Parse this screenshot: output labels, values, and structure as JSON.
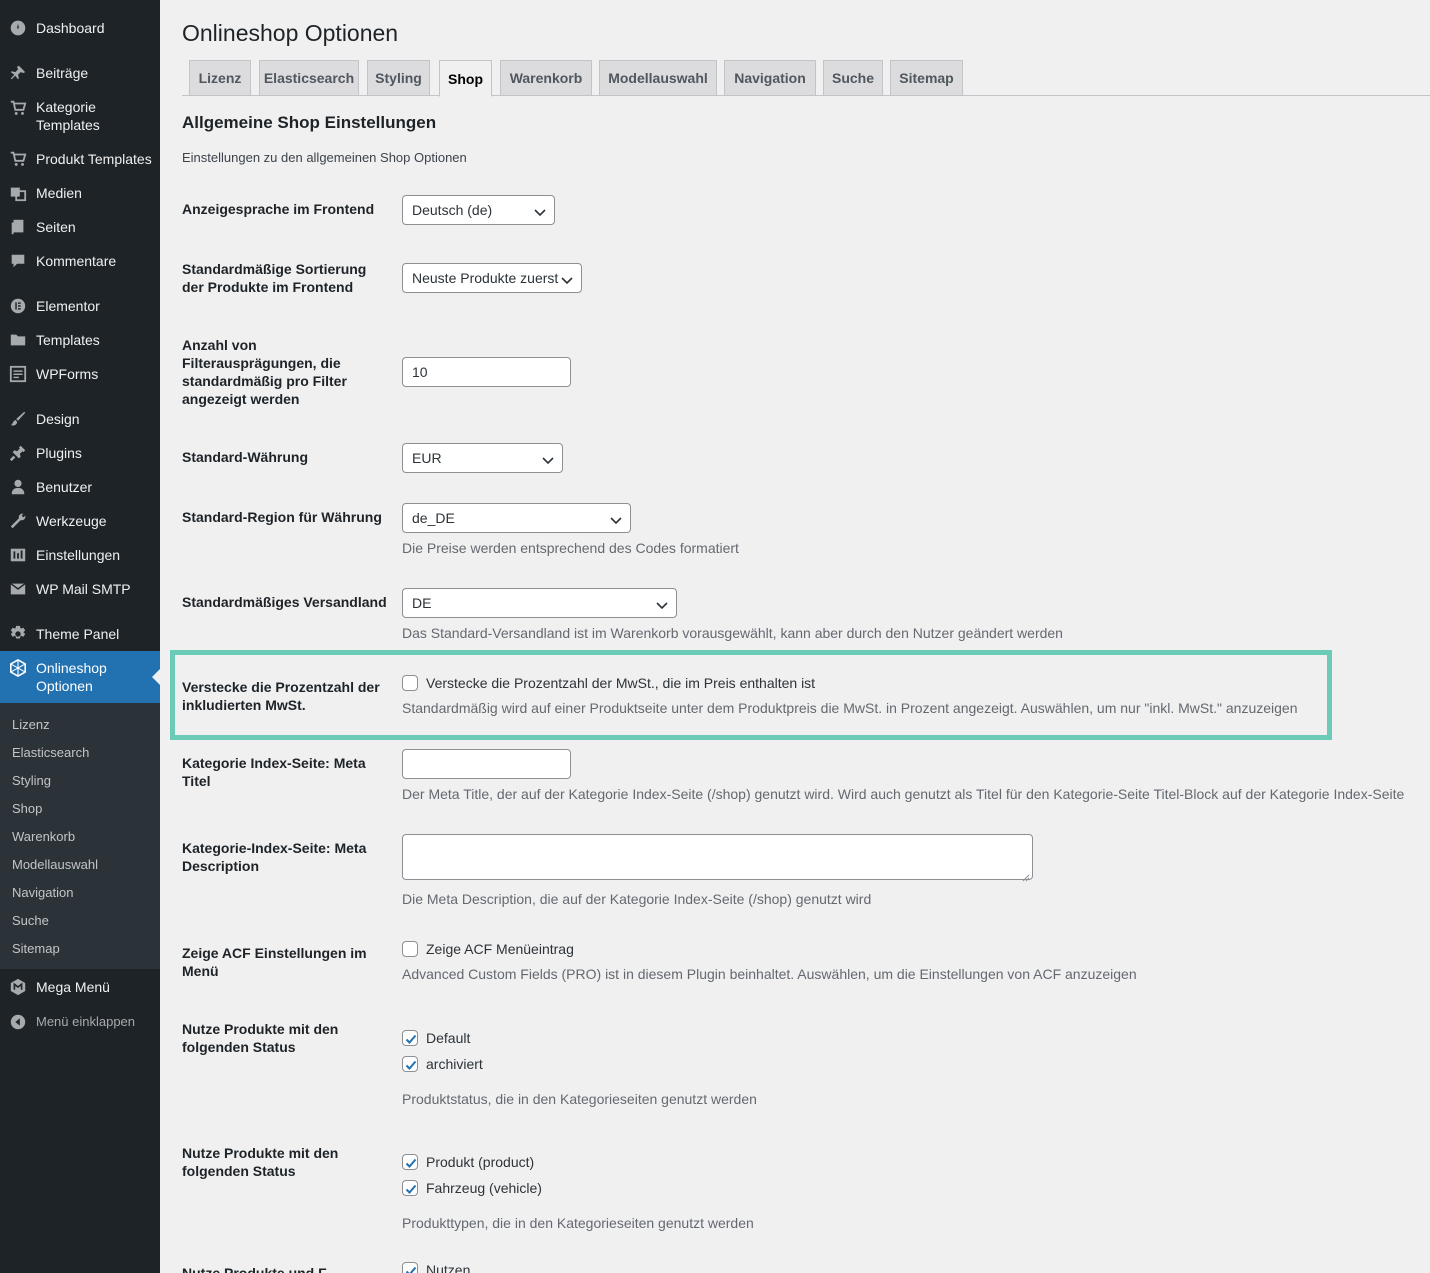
{
  "sidebar": {
    "items": [
      {
        "label": "Dashboard",
        "icon": "dashboard-icon"
      },
      {
        "label": "Beiträge",
        "icon": "pin-icon"
      },
      {
        "label": "Kategorie Templates",
        "line1": "Kategorie",
        "line2": "Templates",
        "icon": "cart-icon"
      },
      {
        "label": "Produkt Templates",
        "icon": "cart-icon"
      },
      {
        "label": "Medien",
        "icon": "media-icon"
      },
      {
        "label": "Seiten",
        "icon": "pages-icon"
      },
      {
        "label": "Kommentare",
        "icon": "comment-icon"
      },
      {
        "label": "Elementor",
        "icon": "elementor-icon"
      },
      {
        "label": "Templates",
        "icon": "folder-icon"
      },
      {
        "label": "WPForms",
        "icon": "forms-icon"
      },
      {
        "label": "Design",
        "icon": "brush-icon"
      },
      {
        "label": "Plugins",
        "icon": "plugin-icon"
      },
      {
        "label": "Benutzer",
        "icon": "user-icon"
      },
      {
        "label": "Werkzeuge",
        "icon": "wrench-icon"
      },
      {
        "label": "Einstellungen",
        "icon": "settings-icon"
      },
      {
        "label": "WP Mail SMTP",
        "icon": "mail-icon"
      },
      {
        "label": "Theme Panel",
        "icon": "gear-icon"
      },
      {
        "label": "Onlineshop Optionen",
        "line1": "Onlineshop",
        "line2": "Optionen",
        "icon": "hexagon-icon"
      },
      {
        "label": "Mega Menü",
        "icon": "megamenu-icon"
      },
      {
        "label": "Menü einklappen",
        "icon": "collapse-icon"
      }
    ],
    "submenu": [
      "Lizenz",
      "Elasticsearch",
      "Styling",
      "Shop",
      "Warenkorb",
      "Modellauswahl",
      "Navigation",
      "Suche",
      "Sitemap"
    ]
  },
  "main": {
    "title": "Onlineshop Optionen",
    "tabs": [
      "Lizenz",
      "Elasticsearch",
      "Styling",
      "Shop",
      "Warenkorb",
      "Modellauswahl",
      "Navigation",
      "Suche",
      "Sitemap"
    ],
    "active_tab": "Shop",
    "section_title": "Allgemeine Shop Einstellungen",
    "section_desc": "Einstellungen zu den allgemeinen Shop Optionen",
    "fields": {
      "language": {
        "label": "Anzeigesprache im Frontend",
        "value": "Deutsch (de)"
      },
      "sorting": {
        "label_1": "Standardmäßige Sortierung",
        "label_2": "der Produkte im Frontend",
        "value": "Neuste Produkte zuerst"
      },
      "filter_count": {
        "label_1": "Anzahl von",
        "label_2": "Filterausprägungen, die",
        "label_3": "standardmäßig pro Filter",
        "label_4": "angezeigt werden",
        "value": "10"
      },
      "currency": {
        "label": "Standard-Währung",
        "value": "EUR"
      },
      "region": {
        "label": "Standard-Region für Währung",
        "value": "de_DE",
        "desc": "Die Preise werden entsprechend des Codes formatiert"
      },
      "shipping_country": {
        "label": "Standardmäßiges Versandland",
        "value": "DE",
        "desc": "Das Standard-Versandland ist im Warenkorb vorausgewählt, kann aber durch den Nutzer geändert werden"
      },
      "hide_vat": {
        "label_1": "Verstecke die Prozentzahl der",
        "label_2": "inkludierten MwSt.",
        "checkbox_label": "Verstecke die Prozentzahl der MwSt., die im Preis enthalten ist",
        "checked": false,
        "desc": "Standardmäßig wird auf einer Produktseite unter dem Produktpreis die MwSt. in Prozent angezeigt. Auswählen, um nur \"inkl. MwSt.\" anzuzeigen"
      },
      "meta_title": {
        "label_1": "Kategorie Index-Seite: Meta",
        "label_2": "Titel",
        "value": "",
        "desc": "Der Meta Title, der auf der Kategorie Index-Seite (/shop) genutzt wird. Wird auch genutzt als Titel für den Kategorie-Seite Titel-Block auf der Kategorie Index-Seite"
      },
      "meta_desc": {
        "label_1": "Kategorie-Index-Seite: Meta",
        "label_2": "Description",
        "value": "",
        "desc": "Die Meta Description, die auf der Kategorie Index-Seite (/shop) genutzt wird"
      },
      "acf": {
        "label_1": "Zeige ACF Einstellungen im",
        "label_2": "Menü",
        "checkbox_label": "Zeige ACF Menüeintrag",
        "checked": false,
        "desc": "Advanced Custom Fields (PRO) ist in diesem Plugin beinhaltet. Auswählen, um die Einstellungen von ACF anzuzeigen"
      },
      "status": {
        "label_1": "Nutze Produkte mit den",
        "label_2": "folgenden Status",
        "options": [
          {
            "label": "Default",
            "checked": true
          },
          {
            "label": "archiviert",
            "checked": true
          }
        ],
        "desc": "Produktstatus, die in den Kategorieseiten genutzt werden"
      },
      "types": {
        "label_1": "Nutze Produkte mit den",
        "label_2": "folgenden Status",
        "options": [
          {
            "label": "Produkt (product)",
            "checked": true
          },
          {
            "label": "Fahrzeug (vehicle)",
            "checked": true
          }
        ],
        "desc": "Produkttypen, die in den Kategorieseiten genutzt werden"
      },
      "partial": {
        "label": "Nutze Produkte und F",
        "checkbox_label": "Nutzen",
        "checked": true
      }
    }
  },
  "colors": {
    "sidebar_bg": "#1d2327",
    "accent": "#2271b1",
    "highlight": "#6ccbb7"
  }
}
